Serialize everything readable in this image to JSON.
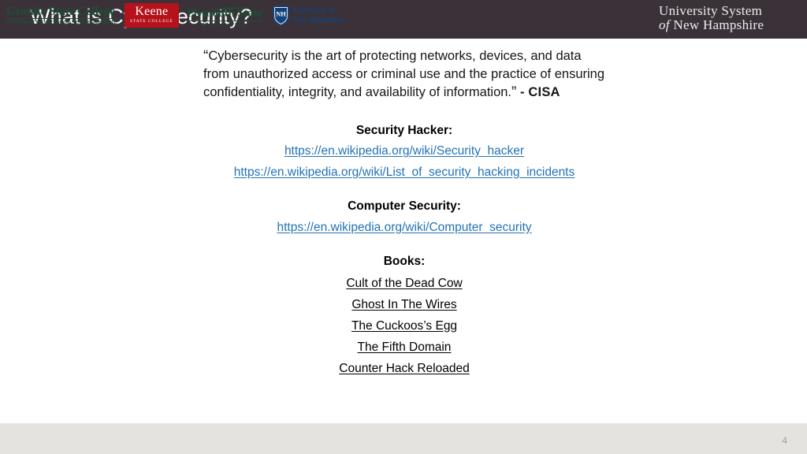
{
  "header": {
    "title": "What is Cybersecurity?",
    "bar_color": "#3b3239",
    "logo": {
      "line1": "University System",
      "line2_italic": "of",
      "line2": "New Hampshire"
    }
  },
  "quote": {
    "open_mark": "“",
    "text": "Cybersecurity is the art of protecting networks, devices, and data from unauthorized access or criminal use and the practice of ensuring confidentiality, integrity, and availability of information.",
    "close_mark": "”",
    "attribution": "- CISA"
  },
  "sections": [
    {
      "heading": "Security Hacker:",
      "links": [
        "https://en.wikipedia.org/wiki/Security_hacker",
        "https://en.wikipedia.org/wiki/List_of_security_hacking_incidents"
      ]
    },
    {
      "heading": "Computer Security:",
      "links": [
        "https://en.wikipedia.org/wiki/Computer_security"
      ]
    }
  ],
  "books": {
    "heading": "Books:",
    "items": [
      "Cult of the Dead Cow",
      "Ghost In The Wires",
      "The Cuckoos’s Egg",
      "The Fifth Domain",
      "Counter Hack Reloaded"
    ]
  },
  "footer": {
    "bar_color": "#e4e3df",
    "logos": {
      "granite": {
        "main": "Granite State College",
        "sub": "University System of New Hampshire",
        "color": "#1d4f36"
      },
      "keene": {
        "main": "Keene",
        "sub": "State College",
        "bg_color": "#b5121b",
        "text_color": "#ffffff"
      },
      "plymouth": {
        "main": "Plymouth State",
        "sub": "University",
        "color": "#1d4f36"
      },
      "unh": {
        "monogram": "NH",
        "line1": "University of",
        "line2": "New Hampshire",
        "color": "#13427c"
      }
    },
    "slide_number": "4"
  },
  "colors": {
    "link": "#2373b5",
    "body_text": "#161616"
  }
}
